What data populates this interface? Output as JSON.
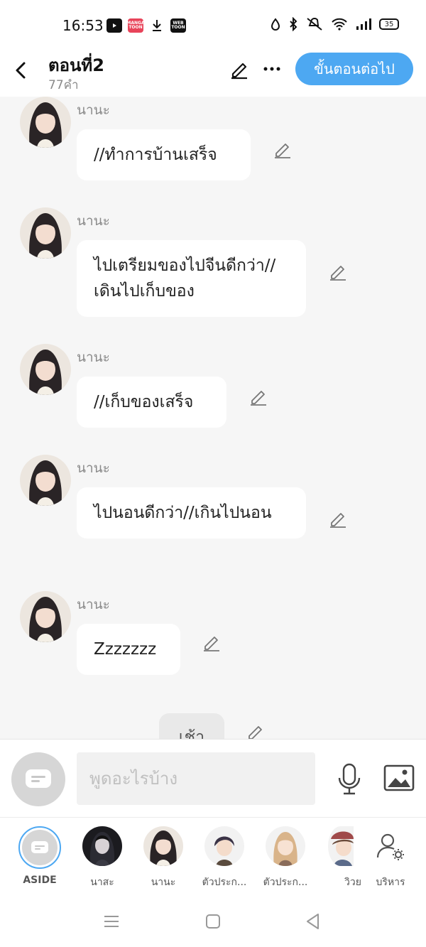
{
  "status_bar": {
    "time": "16:53",
    "app_icons": [
      "youtube-icon",
      "mangatoon-icon",
      "download-icon",
      "webtoon-icon"
    ],
    "battery": "35",
    "right_icons": [
      "data-saver-icon",
      "bluetooth-icon",
      "mute-icon",
      "wifi-icon",
      "signal-icon",
      "battery-icon"
    ]
  },
  "header": {
    "title": "ตอนที่2",
    "word_count": "77คำ",
    "next_button": "ขั้นตอนต่อไป"
  },
  "messages": [
    {
      "sender": "นานะ",
      "text": "//ทำการบ้านเสร็จ"
    },
    {
      "sender": "นานะ",
      "text": "ไปเตรียมของไปจีนดีกว่า//เดินไปเก็บของ"
    },
    {
      "sender": "นานะ",
      "text": "//เก็บของเสร็จ"
    },
    {
      "sender": "นานะ",
      "text": "ไปนอนดีกว่า//เกินไปนอน"
    },
    {
      "sender": "นานะ",
      "text": "Zzzzzzz"
    },
    {
      "sender": "",
      "text": "เช้า"
    }
  ],
  "composer": {
    "placeholder": "พูดอะไรบ้าง"
  },
  "characters": [
    {
      "label": "ASIDE",
      "selected": true
    },
    {
      "label": "นาสะ"
    },
    {
      "label": "นานะ"
    },
    {
      "label": "ตัวประก..."
    },
    {
      "label": "ตัวประก..."
    },
    {
      "label": "วิวย"
    },
    {
      "label": "บริหาร"
    }
  ],
  "colors": {
    "accent": "#4da8f2",
    "background": "#f6f6f6",
    "bubble": "#ffffff"
  }
}
